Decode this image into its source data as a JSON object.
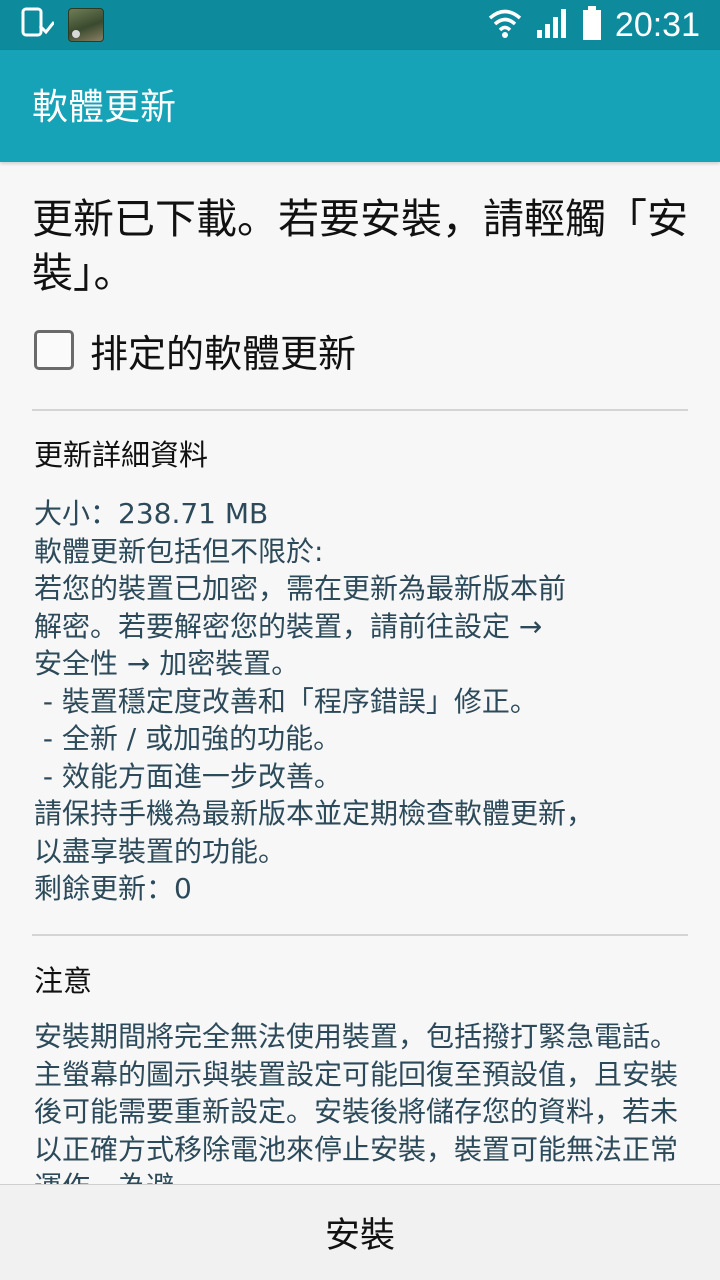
{
  "status_bar": {
    "time": "20:31",
    "icons_left": [
      "device-download-icon",
      "game-thumbnail"
    ],
    "icons_right": [
      "wifi-icon",
      "signal-icon",
      "battery-icon"
    ]
  },
  "app_bar": {
    "title": "軟體更新",
    "color": "#16a3b8"
  },
  "headline": "更新已下載。若要安裝，請輕觸「安裝」。",
  "schedule": {
    "label": "排定的軟體更新",
    "checked": false
  },
  "details": {
    "title": "更新詳細資料",
    "lines": [
      "大小：238.71 MB",
      "軟體更新包括但不限於:",
      "若您的裝置已加密，需在更新為最新版本前",
      "解密。若要解密您的裝置，請前往設定 →",
      "安全性 → 加密裝置。",
      " - 裝置穩定度改善和「程序錯誤」修正。",
      " - 全新 / 或加強的功能。",
      " - 效能方面進一步改善。",
      "請保持手機為最新版本並定期檢查軟體更新，",
      "以盡享裝置的功能。",
      "剩餘更新：0"
    ]
  },
  "notice": {
    "title": "注意",
    "text": "安裝期間將完全無法使用裝置，包括撥打緊急電話。主螢幕的圖示與裝置設定可能回復至預設值，且安裝後可能需要重新設定。安裝後將儲存您的資料，若未以正確方式移除電池來停止安裝，裝置可能無法正常運作。為避"
  },
  "bottom": {
    "install_label": "安裝"
  }
}
